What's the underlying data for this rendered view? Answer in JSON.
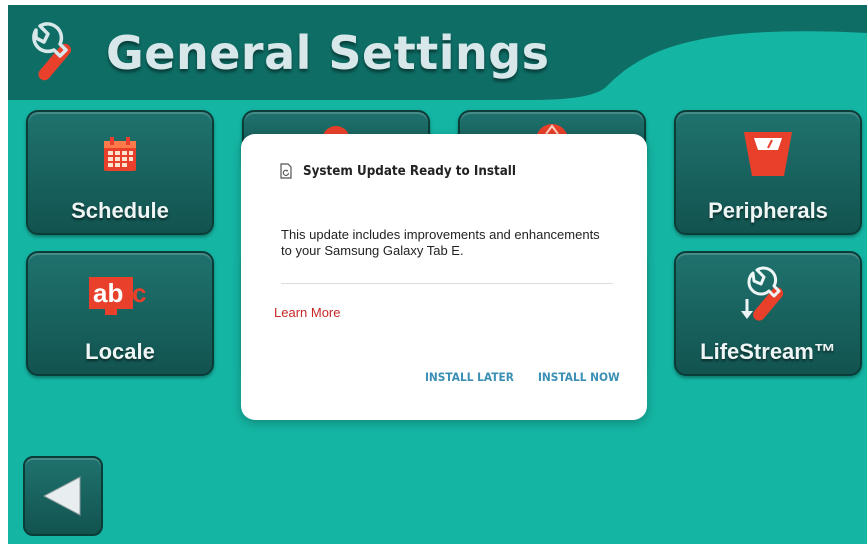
{
  "header": {
    "title": "General Settings",
    "icon": "wrench-icon"
  },
  "tiles": [
    {
      "id": "schedule",
      "label": "Schedule",
      "icon": "calendar-icon"
    },
    {
      "id": "peripherals",
      "label": "Peripherals",
      "icon": "scale-icon"
    },
    {
      "id": "locale",
      "label": "Locale",
      "icon": "abc-icon"
    },
    {
      "id": "lifestream",
      "label": "LifeStream™",
      "icon": "wrench-download-icon"
    }
  ],
  "back_button": {
    "icon": "back-arrow-icon"
  },
  "dialog": {
    "title": "System Update Ready to Install",
    "body": "This update includes improvements and enhancements to your Samsung Galaxy Tab E.",
    "learn_more": "Learn More",
    "install_later": "INSTALL LATER",
    "install_now": "INSTALL NOW"
  },
  "colors": {
    "background": "#15b5a3",
    "header": "#0e6e66",
    "tile": "#186a66",
    "link_red": "#c62828",
    "action_blue": "#3a8fb5",
    "icon_red": "#e8402a"
  }
}
